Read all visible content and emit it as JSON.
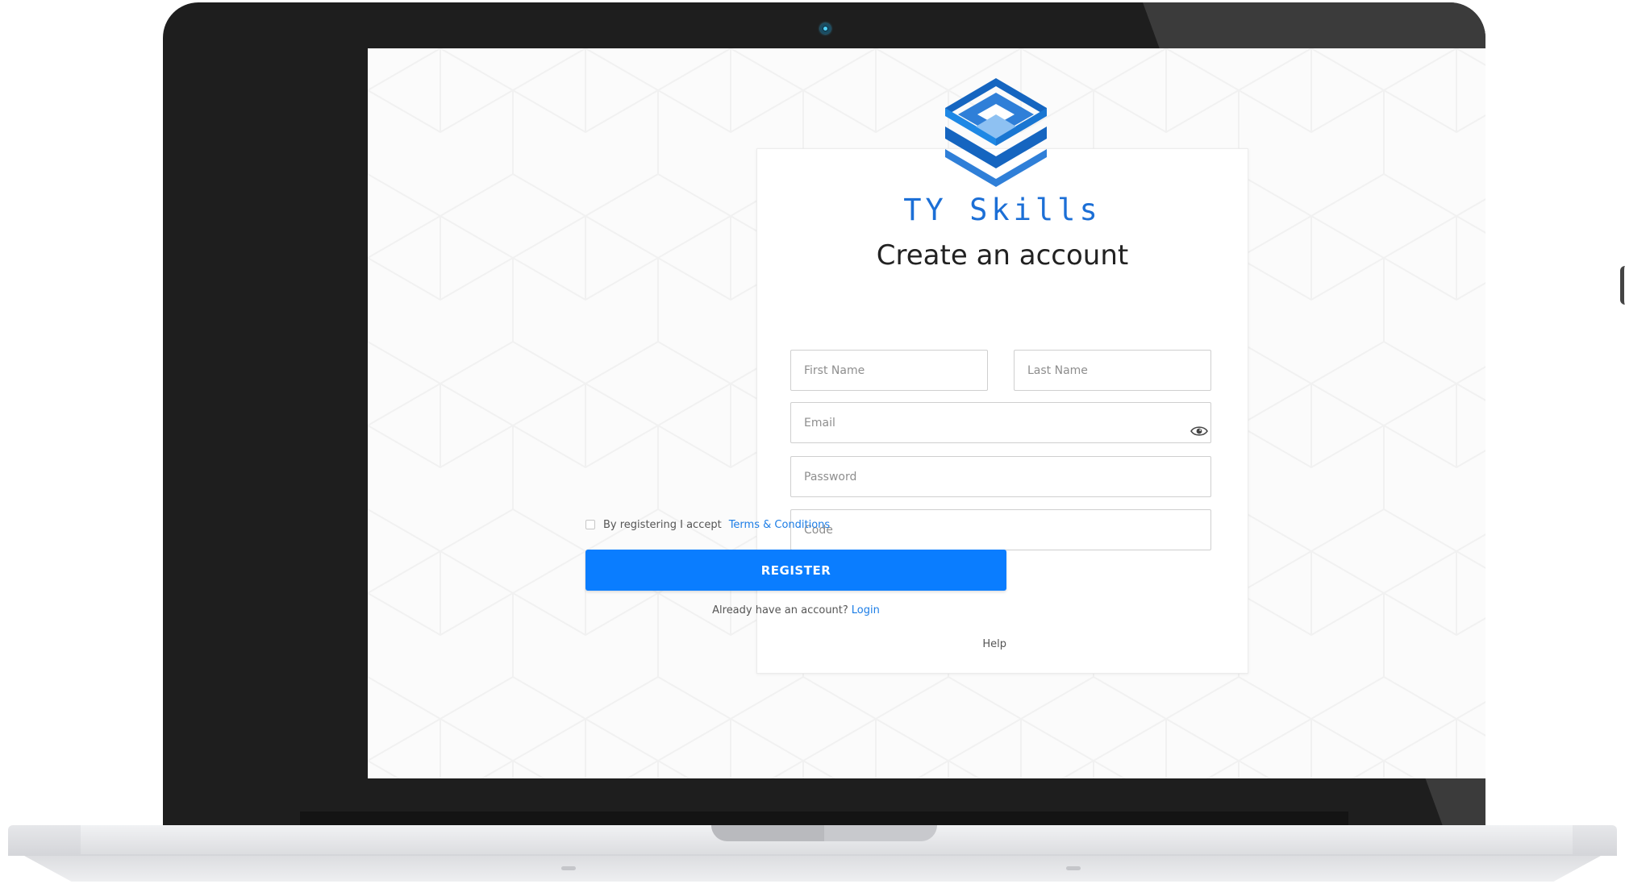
{
  "brand": {
    "name": "TY Skills",
    "logo_icon": "stacked-hexagon-logo",
    "color": "#1c6fd6"
  },
  "form": {
    "title": "Create an account",
    "first_name": {
      "placeholder": "First Name",
      "value": ""
    },
    "last_name": {
      "placeholder": "Last Name",
      "value": ""
    },
    "email": {
      "placeholder": "Email",
      "value": ""
    },
    "password": {
      "placeholder": "Password",
      "value": "",
      "toggle_icon": "eye-icon"
    },
    "code": {
      "placeholder": "Code",
      "value": ""
    },
    "terms": {
      "checked": false,
      "label": "By registering I accept",
      "link_label": "Terms & Conditions"
    },
    "register_label": "REGISTER",
    "login_prompt": "Already have an account?",
    "login_label": "Login",
    "help_label": "Help"
  },
  "colors": {
    "accent": "#0a7dff",
    "link": "#1c7de6",
    "laptop_frame": "#1e1e1e"
  }
}
